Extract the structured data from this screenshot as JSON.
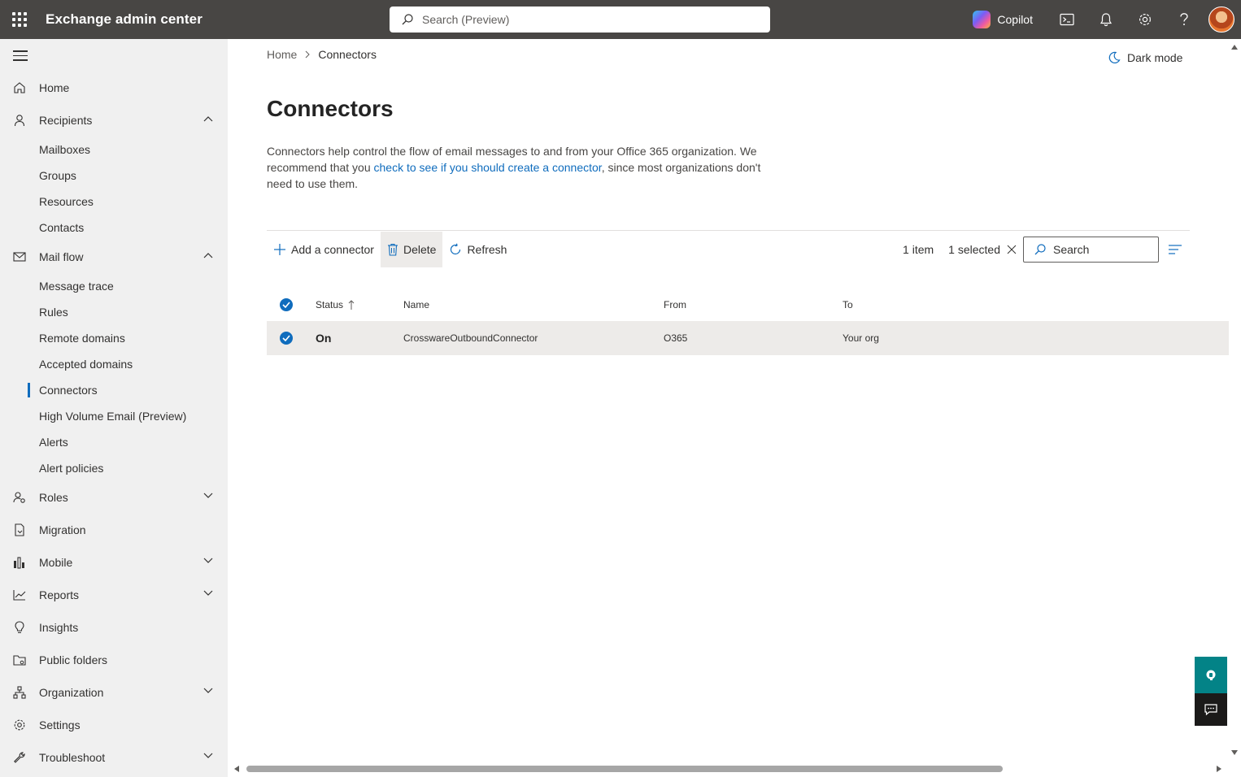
{
  "topbar": {
    "app_title": "Exchange admin center",
    "search_placeholder": "Search (Preview)",
    "copilot_label": "Copilot"
  },
  "sidebar": {
    "items": [
      {
        "label": "Home",
        "icon": "home-icon"
      },
      {
        "label": "Recipients",
        "icon": "person-icon",
        "expanded": true,
        "children": [
          "Mailboxes",
          "Groups",
          "Resources",
          "Contacts"
        ]
      },
      {
        "label": "Mail flow",
        "icon": "mail-icon",
        "expanded": true,
        "children": [
          "Message trace",
          "Rules",
          "Remote domains",
          "Accepted domains",
          "Connectors",
          "High Volume Email (Preview)",
          "Alerts",
          "Alert policies"
        ]
      },
      {
        "label": "Roles",
        "icon": "roles-icon",
        "expanded": false
      },
      {
        "label": "Migration",
        "icon": "migration-icon"
      },
      {
        "label": "Mobile",
        "icon": "mobile-icon",
        "expanded": false
      },
      {
        "label": "Reports",
        "icon": "chart-icon",
        "expanded": false
      },
      {
        "label": "Insights",
        "icon": "lightbulb-icon"
      },
      {
        "label": "Public folders",
        "icon": "folder-icon"
      },
      {
        "label": "Organization",
        "icon": "org-icon",
        "expanded": false
      },
      {
        "label": "Settings",
        "icon": "gear-icon"
      },
      {
        "label": "Troubleshoot",
        "icon": "wrench-icon",
        "expanded": false
      }
    ],
    "active": "Connectors"
  },
  "breadcrumb": {
    "home": "Home",
    "current": "Connectors"
  },
  "darkmode_label": "Dark mode",
  "page": {
    "title": "Connectors",
    "desc_before": "Connectors help control the flow of email messages to and from your Office 365 organization. We recommend that you ",
    "desc_link": "check to see if you should create a connector",
    "desc_after": ", since most organizations don't need to use them."
  },
  "toolbar": {
    "add_label": "Add a connector",
    "delete_label": "Delete",
    "refresh_label": "Refresh",
    "count_label": "1 item",
    "selected_label": "1 selected",
    "search_placeholder": "Search"
  },
  "table": {
    "columns": {
      "status": "Status",
      "name": "Name",
      "from": "From",
      "to": "To"
    },
    "rows": [
      {
        "status": "On",
        "name": "CrosswareOutboundConnector",
        "from": "O365",
        "to": "Your org",
        "selected": true
      }
    ]
  },
  "colors": {
    "topbar": "#484644",
    "sidebar": "#f0f0f0",
    "accent": "#0f6cbd",
    "help_fab": "#038387"
  }
}
